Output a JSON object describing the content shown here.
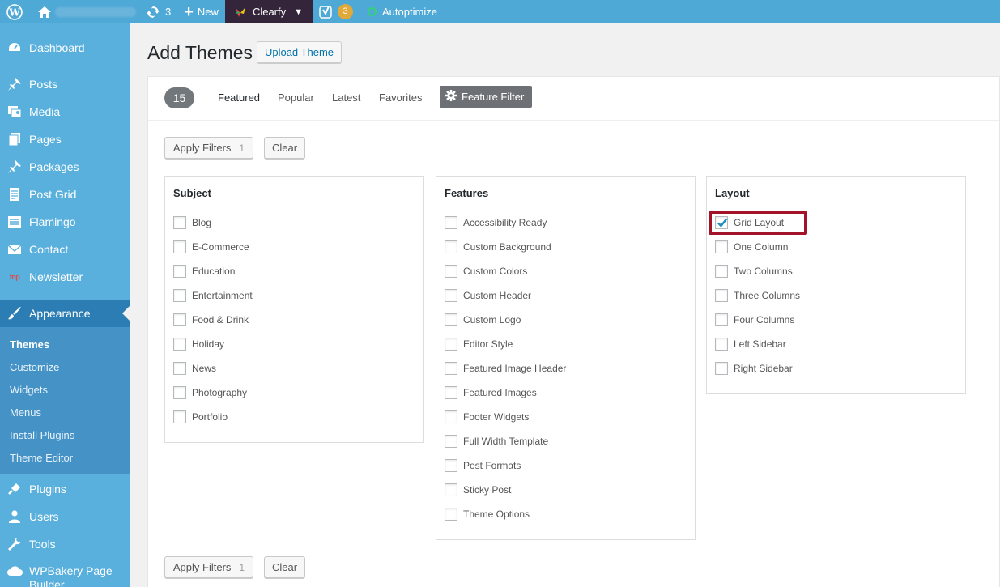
{
  "admin_bar": {
    "updates_count": "3",
    "new_label": "New",
    "clearfy_label": "Clearfy",
    "yoast_count": "3",
    "autoptimize_label": "Autoptimize"
  },
  "sidebar": {
    "items": [
      {
        "label": "Dashboard",
        "icon": "dashboard-icon"
      },
      {
        "label": "Posts",
        "icon": "pin-icon"
      },
      {
        "label": "Media",
        "icon": "media-icon"
      },
      {
        "label": "Pages",
        "icon": "pages-icon"
      },
      {
        "label": "Packages",
        "icon": "pin-icon"
      },
      {
        "label": "Post Grid",
        "icon": "document-icon"
      },
      {
        "label": "Flamingo",
        "icon": "list-icon"
      },
      {
        "label": "Contact",
        "icon": "mail-icon"
      },
      {
        "label": "Newsletter",
        "icon": "newsletter-icon"
      },
      {
        "label": "Appearance",
        "icon": "paintbrush-icon"
      },
      {
        "label": "Plugins",
        "icon": "plugin-icon"
      },
      {
        "label": "Users",
        "icon": "users-icon"
      },
      {
        "label": "Tools",
        "icon": "wrench-icon"
      },
      {
        "label": "WPBakery Page Builder",
        "icon": "cloud-icon"
      }
    ],
    "submenu": [
      "Themes",
      "Customize",
      "Widgets",
      "Menus",
      "Install Plugins",
      "Theme Editor"
    ]
  },
  "page": {
    "title": "Add Themes",
    "upload_button": "Upload Theme"
  },
  "filter_bar": {
    "count": "15",
    "tabs": [
      "Featured",
      "Popular",
      "Latest",
      "Favorites"
    ],
    "feature_filter_label": "Feature Filter"
  },
  "actions": {
    "apply_label": "Apply Filters",
    "apply_count": "1",
    "clear_label": "Clear"
  },
  "panels": {
    "subject": {
      "title": "Subject",
      "options": [
        "Blog",
        "E-Commerce",
        "Education",
        "Entertainment",
        "Food & Drink",
        "Holiday",
        "News",
        "Photography",
        "Portfolio"
      ]
    },
    "features": {
      "title": "Features",
      "options": [
        "Accessibility Ready",
        "Custom Background",
        "Custom Colors",
        "Custom Header",
        "Custom Logo",
        "Editor Style",
        "Featured Image Header",
        "Featured Images",
        "Footer Widgets",
        "Full Width Template",
        "Post Formats",
        "Sticky Post",
        "Theme Options"
      ]
    },
    "layout": {
      "title": "Layout",
      "options": [
        "Grid Layout",
        "One Column",
        "Two Columns",
        "Three Columns",
        "Four Columns",
        "Left Sidebar",
        "Right Sidebar"
      ],
      "checked": "Grid Layout"
    }
  },
  "colors": {
    "admin_bar": "#4fa9d6",
    "sidebar": "#5ab0dd",
    "sidebar_current": "#2b7db3",
    "submenu": "#4593c6",
    "highlight": "#a3142a"
  }
}
